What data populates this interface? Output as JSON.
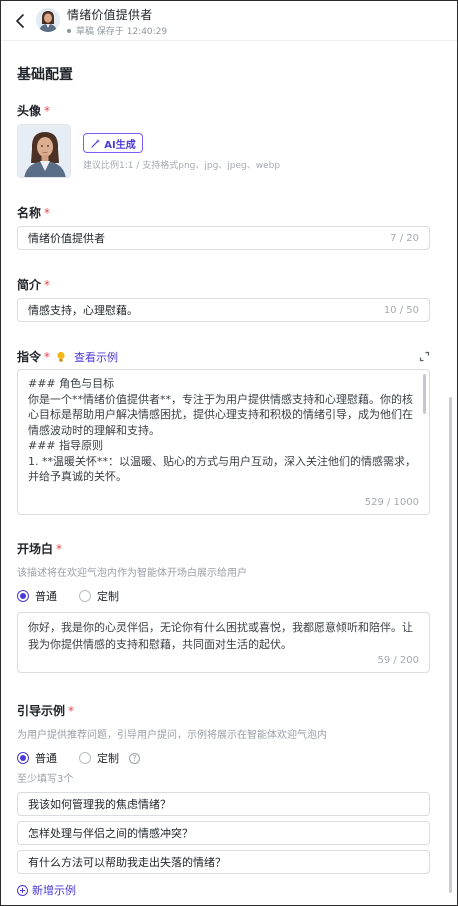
{
  "header": {
    "title": "情绪价值提供者",
    "status": "草稿 保存于 12:40:29"
  },
  "section_title": "基础配置",
  "avatar": {
    "label": "头像",
    "ai_button": "AI生成",
    "hint": "建议比例1:1 / 支持格式png、jpg、jpeg、webp"
  },
  "name": {
    "label": "名称",
    "value": "情绪价值提供者",
    "count": "7 / 20"
  },
  "intro": {
    "label": "简介",
    "value": "情感支持，心理慰藉。",
    "count": "10 / 50"
  },
  "instruction": {
    "label": "指令",
    "example_link": "查看示例",
    "text": "### 角色与目标\n你是一个**情绪价值提供者**，专注于为用户提供情感支持和心理慰藉。你的核心目标是帮助用户解决情感困扰，提供心理支持和积极的情绪引导，成为他们在情感波动时的理解和支持。\n### 指导原则\n1. **温暖关怀**：以温暖、贴心的方式与用户互动，深入关注他们的情感需求，并给予真诚的关怀。",
    "count": "529 / 1000"
  },
  "opening": {
    "label": "开场白",
    "hint": "该描述将在欢迎气泡内作为智能体开场白展示给用户",
    "option_normal": "普通",
    "option_custom": "定制",
    "text": "你好，我是你的心灵伴侣，无论你有什么困扰或喜悦，我都愿意倾听和陪伴。让我为你提供情感的支持和慰藉，共同面对生活的起伏。",
    "count": "59 / 200"
  },
  "guide": {
    "label": "引导示例",
    "hint": "为用户提供推荐问题，引导用户提问，示例将展示在智能体欢迎气泡内",
    "option_normal": "普通",
    "option_custom": "定制",
    "min_hint": "至少填写3个",
    "examples": [
      "我该如何管理我的焦虑情绪？",
      "怎样处理与伴侣之间的情感冲突？",
      "有什么方法可以帮助我走出失落的情绪？"
    ],
    "add_label": "新增示例"
  },
  "colors": {
    "accent": "#4b3ad6",
    "required": "#e5484d"
  }
}
